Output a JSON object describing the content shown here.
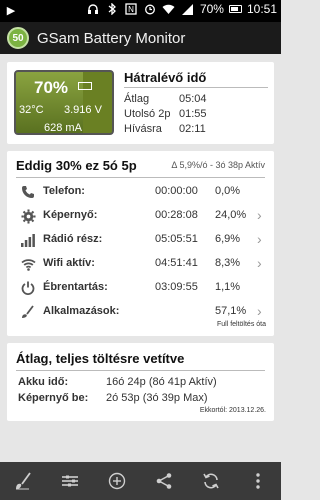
{
  "status_bar": {
    "battery_percent": "70%",
    "time": "10:51",
    "icons": [
      "play-icon",
      "headphones-icon",
      "bluetooth-icon",
      "nfc-icon",
      "alarm-icon",
      "wifi-icon",
      "signal-icon",
      "battery-icon"
    ]
  },
  "app_bar": {
    "logo_text": "50",
    "title": "GSam Battery Monitor"
  },
  "battery_card": {
    "percent": "70%",
    "level": 0.7,
    "temperature": "32°C",
    "voltage": "3.916 V",
    "current": "628 mA",
    "remaining_title": "Hátralévő idő",
    "rows": [
      {
        "label": "Átlag",
        "value": "05:04"
      },
      {
        "label": "Utolsó 2p",
        "value": "01:55"
      },
      {
        "label": "Hívásra",
        "value": "02:11"
      }
    ],
    "accent_color": "#6a8023"
  },
  "usage_card": {
    "title": "Eddig 30% ez 5ó 5p",
    "subtitle": "Δ 5,9%/ó - 3ó 38p Aktív",
    "rows": [
      {
        "icon": "phone-icon",
        "label": "Telefon:",
        "time": "00:00:00",
        "percent": "0,0%",
        "chevron": false
      },
      {
        "icon": "gear-icon",
        "label": "Képernyő:",
        "time": "00:28:08",
        "percent": "24,0%",
        "chevron": true
      },
      {
        "icon": "signal-bars-icon",
        "label": "Rádió rész:",
        "time": "05:05:51",
        "percent": "6,9%",
        "chevron": true
      },
      {
        "icon": "wifi-icon",
        "label": "Wifi aktív:",
        "time": "04:51:41",
        "percent": "8,3%",
        "chevron": true
      },
      {
        "icon": "power-icon",
        "label": "Ébrentartás:",
        "time": "03:09:55",
        "percent": "1,1%",
        "chevron": false
      },
      {
        "icon": "apps-brush-icon",
        "label": "Alkalmazások:",
        "time": "",
        "percent": "57,1%",
        "chevron": true
      }
    ],
    "footer": "Full feltöltés óta"
  },
  "projection_card": {
    "title": "Átlag, teljes töltésre vetítve",
    "rows": [
      {
        "label": "Akku idő:",
        "value": "16ó 24p (8ó 41p Aktív)"
      },
      {
        "label": "Képernyő be:",
        "value": "2ó 53p (3ó 39p Max)"
      }
    ],
    "footer": "Ekkortól: 2013.12.26."
  },
  "toolbar": {
    "buttons": [
      "brush-icon",
      "equalizer-icon",
      "add-icon",
      "share-icon",
      "refresh-icon",
      "more-icon"
    ]
  }
}
